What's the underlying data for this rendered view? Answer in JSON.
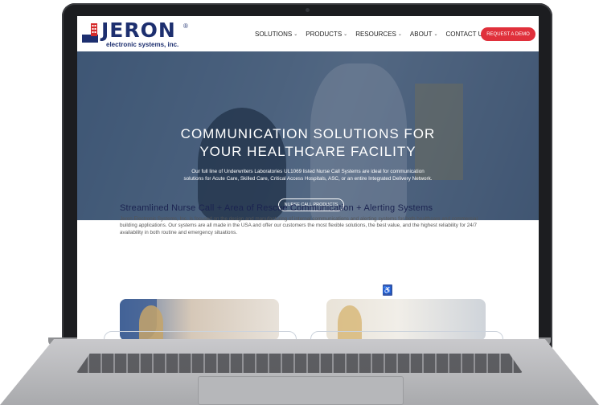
{
  "logo": {
    "name": "JERON",
    "registered": "®",
    "tagline": "electronic systems, inc."
  },
  "nav": {
    "items": [
      {
        "label": "SOLUTIONS"
      },
      {
        "label": "PRODUCTS"
      },
      {
        "label": "RESOURCES"
      },
      {
        "label": "ABOUT"
      },
      {
        "label": "CONTACT US"
      }
    ],
    "cta_label": "REQUEST A DEMO"
  },
  "hero": {
    "title_line1": "COMMUNICATION SOLUTIONS FOR",
    "title_line2": "YOUR HEALTHCARE FACILITY",
    "description": "Our full line of Underwriters Laboratories UL1069 listed Nurse Call Systems are ideal for communication solutions for Acute Care, Skilled Care, Critical Access Hospitals, ASC, or an entire Integrated Delivery Network.",
    "button_label": "NURSE CALL PRODUCTS"
  },
  "intro": {
    "title": "Streamlined Nurse Call + Area of Rescue Communication + Alerting Systems",
    "body": "Jeron Electronic Systems, Inc. is focused on the design and manufacturing of internal communications and alerting systems for both healthcare and commercial building applications. Our systems are all made in the USA and offer our customers the most flexible solutions, the best value, and the highest reliability for 24/7 availability in both routine and emergency situations."
  },
  "colors": {
    "brand_navy": "#1d2f6f",
    "cta_red": "#e0303b"
  }
}
